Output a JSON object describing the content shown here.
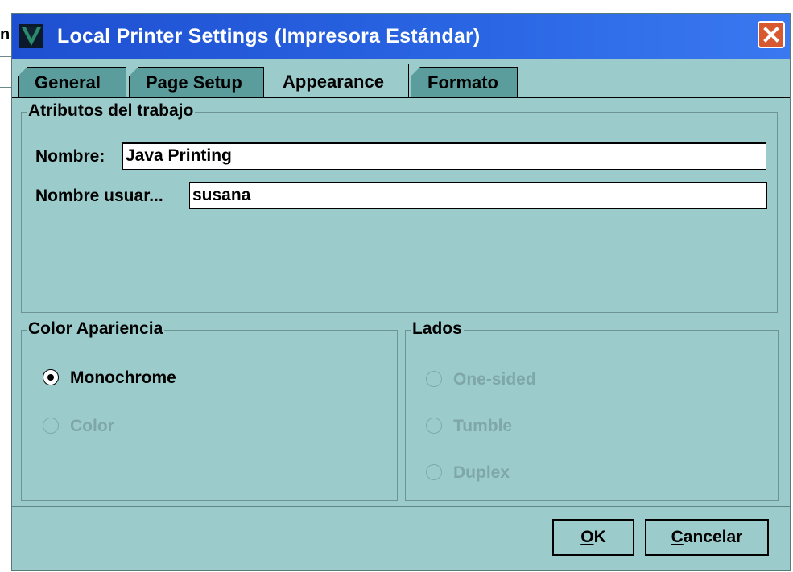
{
  "dialog": {
    "title": "Local Printer Settings (Impresora Estándar)"
  },
  "background_window": {
    "glyph": "n"
  },
  "tabs": [
    {
      "label": "General",
      "active": false
    },
    {
      "label": "Page Setup",
      "active": false
    },
    {
      "label": "Appearance",
      "active": true
    },
    {
      "label": "Formato",
      "active": false
    }
  ],
  "job_attributes": {
    "legend": "Atributos del trabajo",
    "name_label": "Nombre:",
    "name_value": "Java Printing",
    "user_label": "Nombre usuar...",
    "user_value": "susana"
  },
  "color_appearance": {
    "legend": "Color Apariencia",
    "options": [
      {
        "label": "Monochrome",
        "selected": true,
        "enabled": true
      },
      {
        "label": "Color",
        "selected": false,
        "enabled": false
      }
    ]
  },
  "sides": {
    "legend": "Lados",
    "options": [
      {
        "label": "One-sided",
        "selected": false,
        "enabled": false
      },
      {
        "label": "Tumble",
        "selected": false,
        "enabled": false
      },
      {
        "label": "Duplex",
        "selected": false,
        "enabled": false
      }
    ]
  },
  "buttons": {
    "ok_mnemonic": "O",
    "ok_rest": "K",
    "cancel_mnemonic": "C",
    "cancel_rest": "ancelar"
  },
  "colors": {
    "panel": "#9ccbcb",
    "tab_inactive": "#5b9c9c",
    "titlebar": "#2a66e4",
    "close": "#d8582f"
  }
}
